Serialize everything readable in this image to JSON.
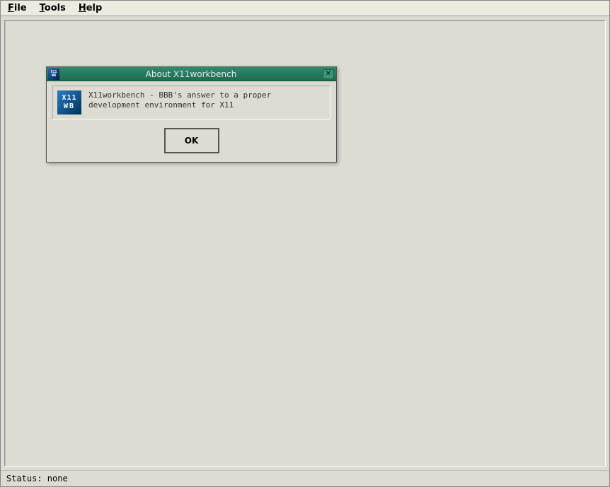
{
  "menubar": {
    "file": "File",
    "tools": "Tools",
    "help": "Help"
  },
  "statusbar": {
    "text": "Status: none"
  },
  "dialog": {
    "title": "About X11workbench",
    "icon": {
      "line1": "X11",
      "line2": "WB"
    },
    "message": "X11workbench - BBB's answer to a proper development environment for X11",
    "ok_label": "OK"
  }
}
